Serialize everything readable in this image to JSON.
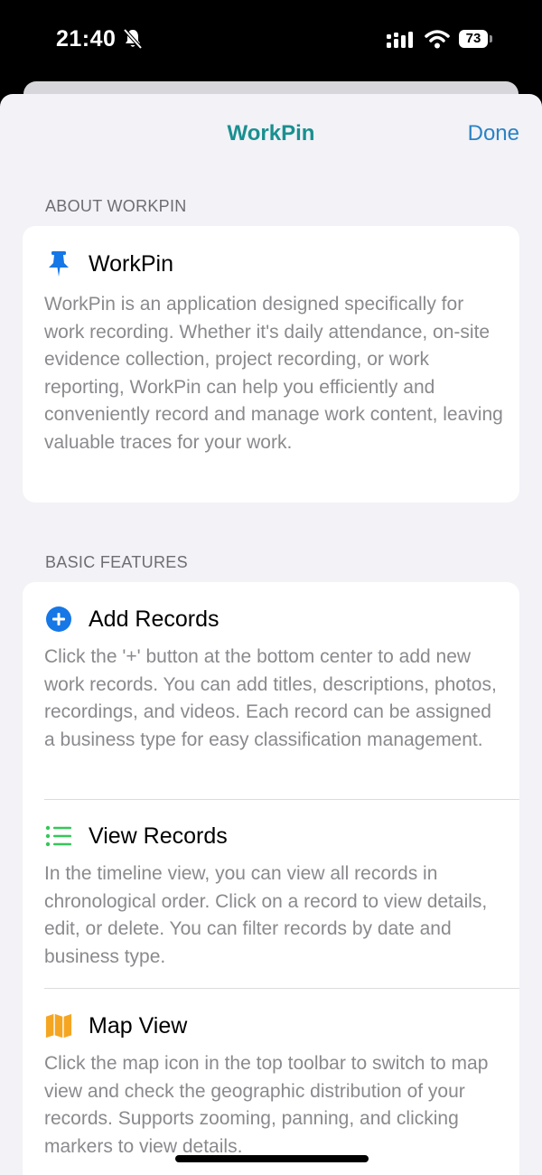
{
  "status_bar": {
    "time": "21:40",
    "battery": "73"
  },
  "nav": {
    "title": "WorkPin",
    "done_label": "Done"
  },
  "about": {
    "header": "ABOUT WORKPIN",
    "title": "WorkPin",
    "icon": "pin-icon",
    "description": "WorkPin is an application designed specifically for work recording. Whether it's daily attendance, on-site evidence collection, project recording, or work reporting, WorkPin can help you efficiently and conveniently record and manage work content, leaving valuable traces for your work."
  },
  "features": {
    "header": "BASIC FEATURES",
    "items": [
      {
        "icon": "plus-circle-icon",
        "title": "Add Records",
        "description": "Click the '+' button at the bottom center to add new work records. You can add titles, descriptions, photos, recordings, and videos. Each record can be assigned a business type for easy classification management."
      },
      {
        "icon": "list-icon",
        "title": "View Records",
        "description": "In the timeline view, you can view all records in chronological order. Click on a record to view details, edit, or delete. You can filter records by date and business type."
      },
      {
        "icon": "map-icon",
        "title": "Map View",
        "description": "Click the map icon in the top toolbar to switch to map view and check the geographic distribution of your records. Supports zooming, panning, and clicking markers to view details."
      }
    ]
  },
  "colors": {
    "accent_teal": "#1a8f8f",
    "link_blue": "#2b82c4",
    "icon_blue": "#1677e6",
    "list_green": "#34c759",
    "map_orange": "#f4a623"
  }
}
